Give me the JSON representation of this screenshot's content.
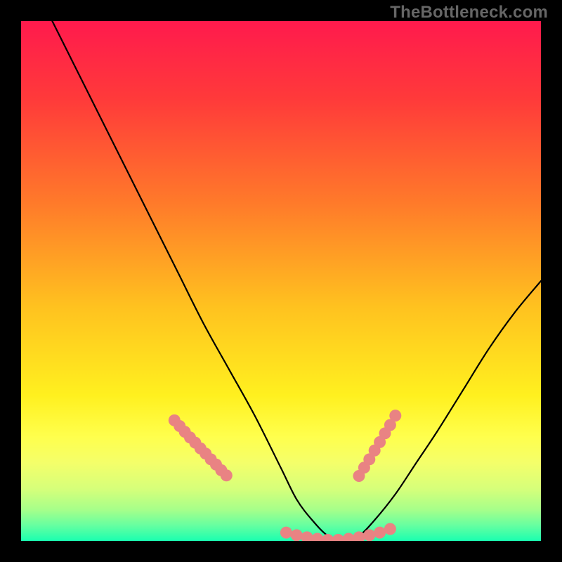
{
  "watermark": "TheBottleneck.com",
  "chart_data": {
    "type": "line",
    "title": "",
    "xlabel": "",
    "ylabel": "",
    "xlim": [
      0,
      100
    ],
    "ylim": [
      0,
      100
    ],
    "curve": {
      "name": "bottleneck-curve",
      "x": [
        6,
        10,
        15,
        20,
        25,
        30,
        35,
        40,
        45,
        50,
        53,
        56,
        59,
        62,
        65,
        68,
        72,
        76,
        80,
        85,
        90,
        95,
        100
      ],
      "y": [
        100,
        92,
        82,
        72,
        62,
        52,
        42,
        33,
        24,
        14,
        8,
        4,
        1,
        0,
        1,
        4,
        9,
        15,
        21,
        29,
        37,
        44,
        50
      ]
    },
    "markers_left": {
      "name": "left-segment",
      "x": [
        29.5,
        30.5,
        31.5,
        32.5,
        33.5,
        34.5,
        35.5,
        36.5,
        37.5,
        38.5,
        39.5
      ],
      "y": [
        23.2,
        22.1,
        21.0,
        19.9,
        18.9,
        17.8,
        16.8,
        15.7,
        14.7,
        13.6,
        12.6
      ]
    },
    "markers_bottom": {
      "name": "bottom-segment",
      "x": [
        51,
        53,
        55,
        57,
        59,
        61,
        63,
        65,
        67,
        69,
        71
      ],
      "y": [
        1.6,
        1.1,
        0.7,
        0.4,
        0.2,
        0.2,
        0.4,
        0.7,
        1.1,
        1.6,
        2.3
      ]
    },
    "markers_right": {
      "name": "right-segment",
      "x": [
        65,
        66,
        67,
        68,
        69,
        70,
        71,
        72
      ],
      "y": [
        12.5,
        14.1,
        15.7,
        17.4,
        19.0,
        20.7,
        22.3,
        24.1
      ]
    },
    "gradient_stops": [
      {
        "offset": 0.0,
        "color": "#ff1a4d"
      },
      {
        "offset": 0.15,
        "color": "#ff3a3a"
      },
      {
        "offset": 0.35,
        "color": "#ff7a2a"
      },
      {
        "offset": 0.55,
        "color": "#ffc21f"
      },
      {
        "offset": 0.72,
        "color": "#fff01f"
      },
      {
        "offset": 0.8,
        "color": "#ffff4d"
      },
      {
        "offset": 0.85,
        "color": "#f4ff6a"
      },
      {
        "offset": 0.9,
        "color": "#d6ff7a"
      },
      {
        "offset": 0.94,
        "color": "#a6ff8a"
      },
      {
        "offset": 0.97,
        "color": "#66ffa0"
      },
      {
        "offset": 1.0,
        "color": "#1affb0"
      }
    ],
    "marker_color": "#e98383",
    "curve_color": "#000000"
  }
}
